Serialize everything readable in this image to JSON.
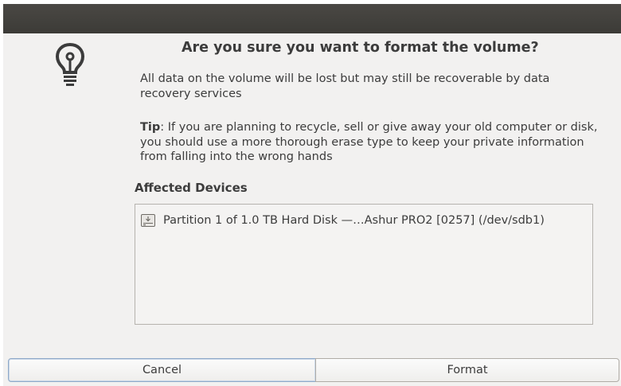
{
  "dialog": {
    "heading": "Are you sure you want to format the volume?",
    "message": "All data on the volume will be lost but may still be recoverable by data recovery services",
    "tip_label": "Tip",
    "tip_text": ": If you are planning to recycle, sell or give away your old computer or disk, you should use a more thorough erase type to keep your private information from falling into the wrong hands",
    "icon": "lightbulb-icon"
  },
  "affected_devices": {
    "title": "Affected Devices",
    "items": [
      {
        "icon": "hard-disk-icon",
        "label": "Partition 1 of 1.0 TB Hard Disk —…Ashur PRO2 [0257] (/dev/sdb1)"
      }
    ]
  },
  "buttons": {
    "cancel_label": "Cancel",
    "format_label": "Format"
  },
  "colors": {
    "titlebar": "#3c3b37",
    "dialog_background": "#f2f1f0",
    "text": "#3c3c3c",
    "focus_border": "#8fa9c8"
  }
}
